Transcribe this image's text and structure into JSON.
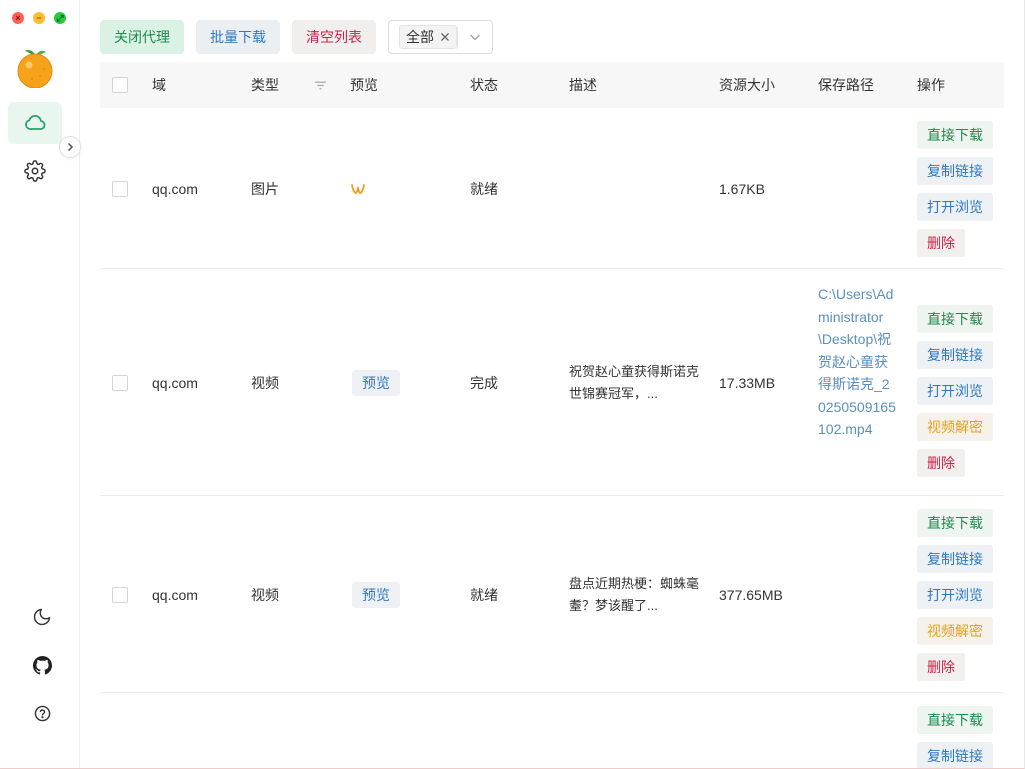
{
  "window": {
    "controls": [
      "×",
      "−",
      "⤢"
    ]
  },
  "sidebar": {
    "logo": "orange-logo",
    "nav": [
      {
        "icon": "cloud-icon",
        "active": true
      },
      {
        "icon": "gear-icon",
        "active": false
      }
    ],
    "bottom": [
      "moon-icon",
      "github-icon",
      "help-icon"
    ]
  },
  "toolbar": {
    "close_proxy": "关闭代理",
    "batch_download": "批量下载",
    "clear_list": "清空列表",
    "filter_chip": "全部"
  },
  "table": {
    "headers": {
      "domain": "域",
      "type": "类型",
      "preview": "预览",
      "status": "状态",
      "desc": "描述",
      "size": "资源大小",
      "path": "保存路径",
      "ops": "操作"
    },
    "ops_labels": {
      "download": "直接下载",
      "copy": "复制链接",
      "open": "打开浏览",
      "decrypt": "视频解密",
      "delete": "删除"
    },
    "rows": [
      {
        "domain": "qq.com",
        "type": "图片",
        "preview": "",
        "status": "就绪",
        "desc": "",
        "size": "1.67KB",
        "path": ""
      },
      {
        "domain": "qq.com",
        "type": "视频",
        "preview": "预览",
        "status": "完成",
        "desc": "祝贺赵心童获得斯诺克世锦赛冠军，...",
        "size": "17.33MB",
        "path": "C:\\Users\\Administrator\\Desktop\\祝贺赵心童获得斯诺克_20250509165102.mp4"
      },
      {
        "domain": "qq.com",
        "type": "视频",
        "preview": "预览",
        "status": "就绪",
        "desc": "盘点近期热梗：蜘蛛毫耋？梦该醒了...",
        "size": "377.65MB",
        "path": ""
      }
    ]
  },
  "colors": {
    "accent_green": "#1e8a4d",
    "accent_blue": "#2c79c5",
    "danger_red": "#cc2244",
    "warning_orange": "#e3a021"
  }
}
